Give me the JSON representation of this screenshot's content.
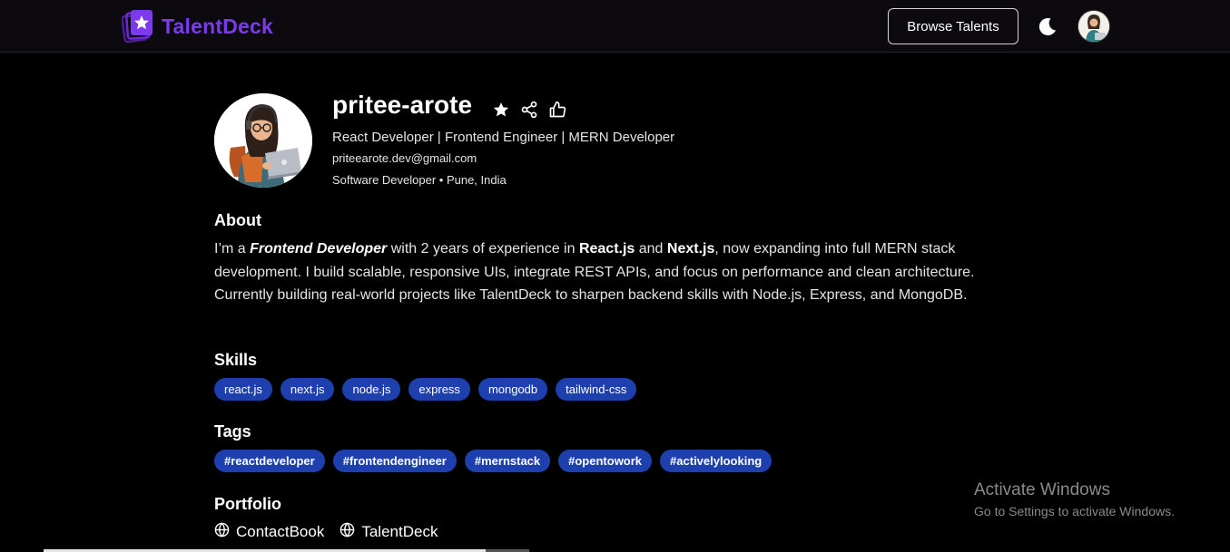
{
  "header": {
    "logo_text": "TalentDeck",
    "browse_label": "Browse Talents",
    "theme_icon": "moon-icon",
    "avatar_icon": "user-avatar"
  },
  "profile": {
    "username": "pritee-arote",
    "headline": "React Developer | Frontend Engineer | MERN Developer",
    "email": "priteearote.dev@gmail.com",
    "meta": "Software Developer • Pune, India",
    "action_icons": [
      "star-icon",
      "share-icon",
      "thumbs-up-icon"
    ]
  },
  "about": {
    "title": "About",
    "p1": "I’m a ",
    "b1": "Frontend Developer",
    "p2": " with 2 years of experience in ",
    "b2": "React.js",
    "p3": " and ",
    "b3": "Next.js",
    "p4": ", now expanding into full MERN stack development. I build scalable, responsive UIs, integrate REST APIs, and focus on performance and clean architecture. Currently building real-world projects like TalentDeck to sharpen backend skills with Node.js, Express, and MongoDB."
  },
  "skills": {
    "title": "Skills",
    "items": [
      "react.js",
      "next.js",
      "node.js",
      "express",
      "mongodb",
      "tailwind-css"
    ]
  },
  "tags": {
    "title": "Tags",
    "items": [
      "#reactdeveloper",
      "#frontendengineer",
      "#mernstack",
      "#opentowork",
      "#activelylooking"
    ]
  },
  "portfolio": {
    "title": "Portfolio",
    "links": [
      "ContactBook",
      "TalentDeck"
    ]
  },
  "watermark": {
    "title": "Activate Windows",
    "subtitle": "Go to Settings to activate Windows."
  },
  "colors": {
    "brand": "#7c3aed",
    "chip": "#1e40af",
    "background": "#000000"
  }
}
